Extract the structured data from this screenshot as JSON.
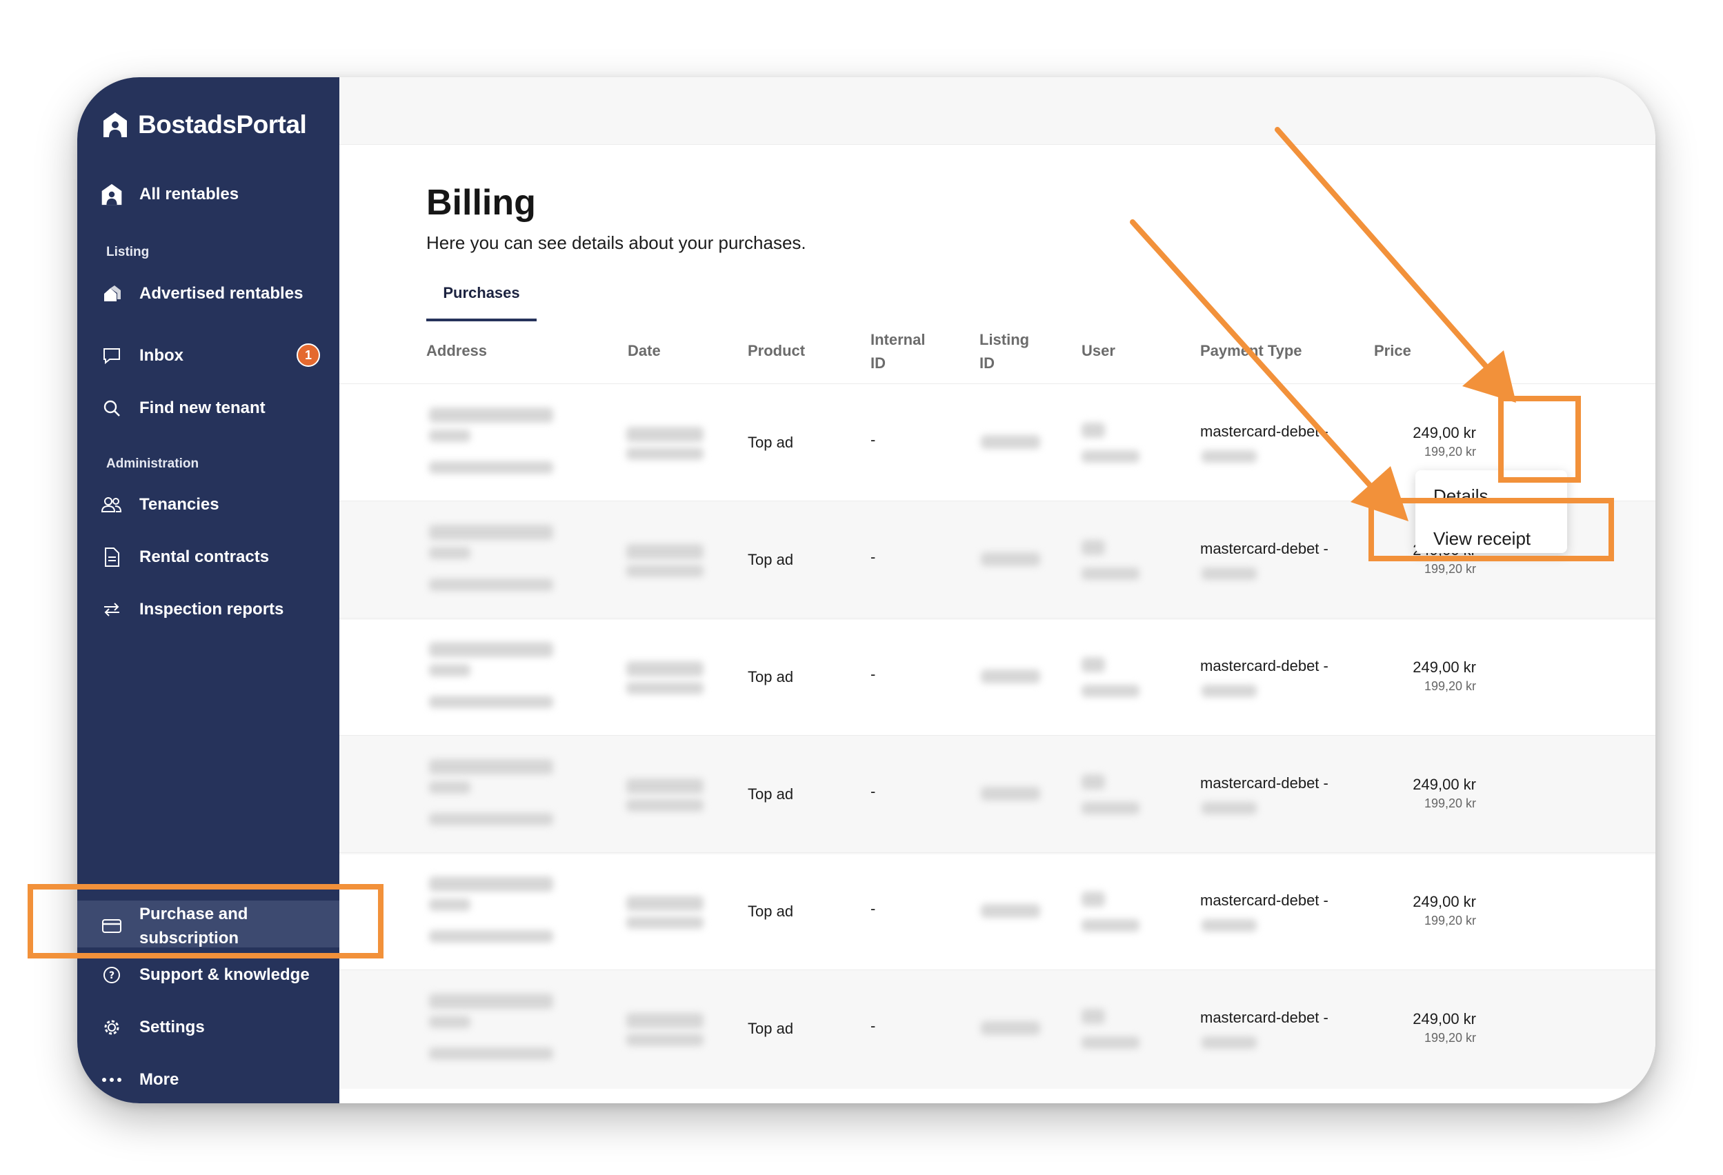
{
  "app": {
    "brand": "BostadsPortal"
  },
  "sidebar": {
    "top_item": "All rentables",
    "sections": {
      "listing": "Listing",
      "administration": "Administration"
    },
    "items": {
      "advertised": "Advertised rentables",
      "inbox": "Inbox",
      "inbox_badge": "1",
      "find_tenant": "Find new tenant",
      "tenancies": "Tenancies",
      "rental_contracts": "Rental contracts",
      "inspection_reports": "Inspection reports",
      "purchase_line1": "Purchase and",
      "purchase_line2": "subscription",
      "support": "Support & knowledge",
      "settings": "Settings",
      "more": "More"
    }
  },
  "page": {
    "title": "Billing",
    "subtitle": "Here you can see details about your purchases.",
    "tab": "Purchases"
  },
  "table": {
    "headers": {
      "address": "Address",
      "date": "Date",
      "product": "Product",
      "internal_1": "Internal",
      "internal_2": "ID",
      "listing_1": "Listing",
      "listing_2": "ID",
      "user": "User",
      "payment": "Payment Type",
      "price": "Price"
    },
    "rows": [
      {
        "product": "Top ad",
        "internal_id": "-",
        "payment": "mastercard-debet -",
        "price": "249,00 kr",
        "vat": "199,20 kr"
      },
      {
        "product": "Top ad",
        "internal_id": "-",
        "payment": "mastercard-debet -",
        "price": "249,00 kr",
        "vat": "199,20 kr"
      },
      {
        "product": "Top ad",
        "internal_id": "-",
        "payment": "mastercard-debet -",
        "price": "249,00 kr",
        "vat": "199,20 kr"
      },
      {
        "product": "Top ad",
        "internal_id": "-",
        "payment": "mastercard-debet -",
        "price": "249,00 kr",
        "vat": "199,20 kr"
      },
      {
        "product": "Top ad",
        "internal_id": "-",
        "payment": "mastercard-debet -",
        "price": "249,00 kr",
        "vat": "199,20 kr"
      },
      {
        "product": "Top ad",
        "internal_id": "-",
        "payment": "mastercard-debet -",
        "price": "249,00 kr",
        "vat": "199,20 kr"
      }
    ]
  },
  "row_menu": {
    "details": "Details",
    "view_receipt": "View receipt"
  },
  "colors": {
    "sidebar": "#26335b",
    "accent_orange": "#f2913a",
    "badge": "#e4692f",
    "tab_underline": "#26335b"
  }
}
